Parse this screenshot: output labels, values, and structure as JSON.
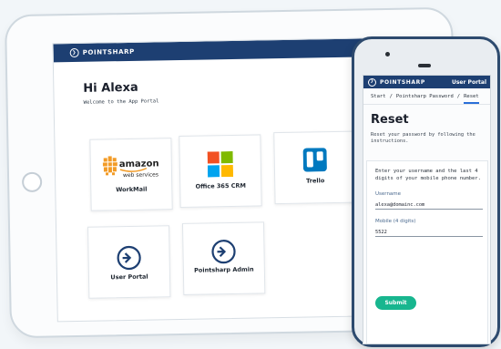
{
  "brand": {
    "name": "POINTSHARP"
  },
  "tablet": {
    "greeting": "Hi Alexa",
    "welcome": "Welcome to the App Portal",
    "tiles": [
      {
        "label": "WorkMail",
        "icon": "amazon-web-services-logo"
      },
      {
        "label": "Office 365 CRM",
        "icon": "microsoft-logo"
      },
      {
        "label": "Trello",
        "icon": "trello-logo"
      },
      {
        "label": "User Portal",
        "icon": "pointsharp-icon"
      },
      {
        "label": "Pointsharp Admin",
        "icon": "pointsharp-icon"
      }
    ],
    "amazon_logo": {
      "line1": "amazon",
      "line2": "web services"
    }
  },
  "phone": {
    "header_link": "User Portal",
    "breadcrumb": [
      "Start",
      "Pointsharp Password",
      "Reset"
    ],
    "title": "Reset",
    "subtitle": "Reset your password by following the instructions.",
    "instructions": "Enter your username and the last 4 digits of your mobile phone number.",
    "username_label": "Username",
    "username_value": "alexa@domainc.com",
    "mobile_label": "Mobile (4 digits)",
    "mobile_value": "5522",
    "submit_label": "Submit"
  },
  "colors": {
    "header": "#1d3f72",
    "accent": "#18b68f",
    "link": "#2a6fd8"
  }
}
